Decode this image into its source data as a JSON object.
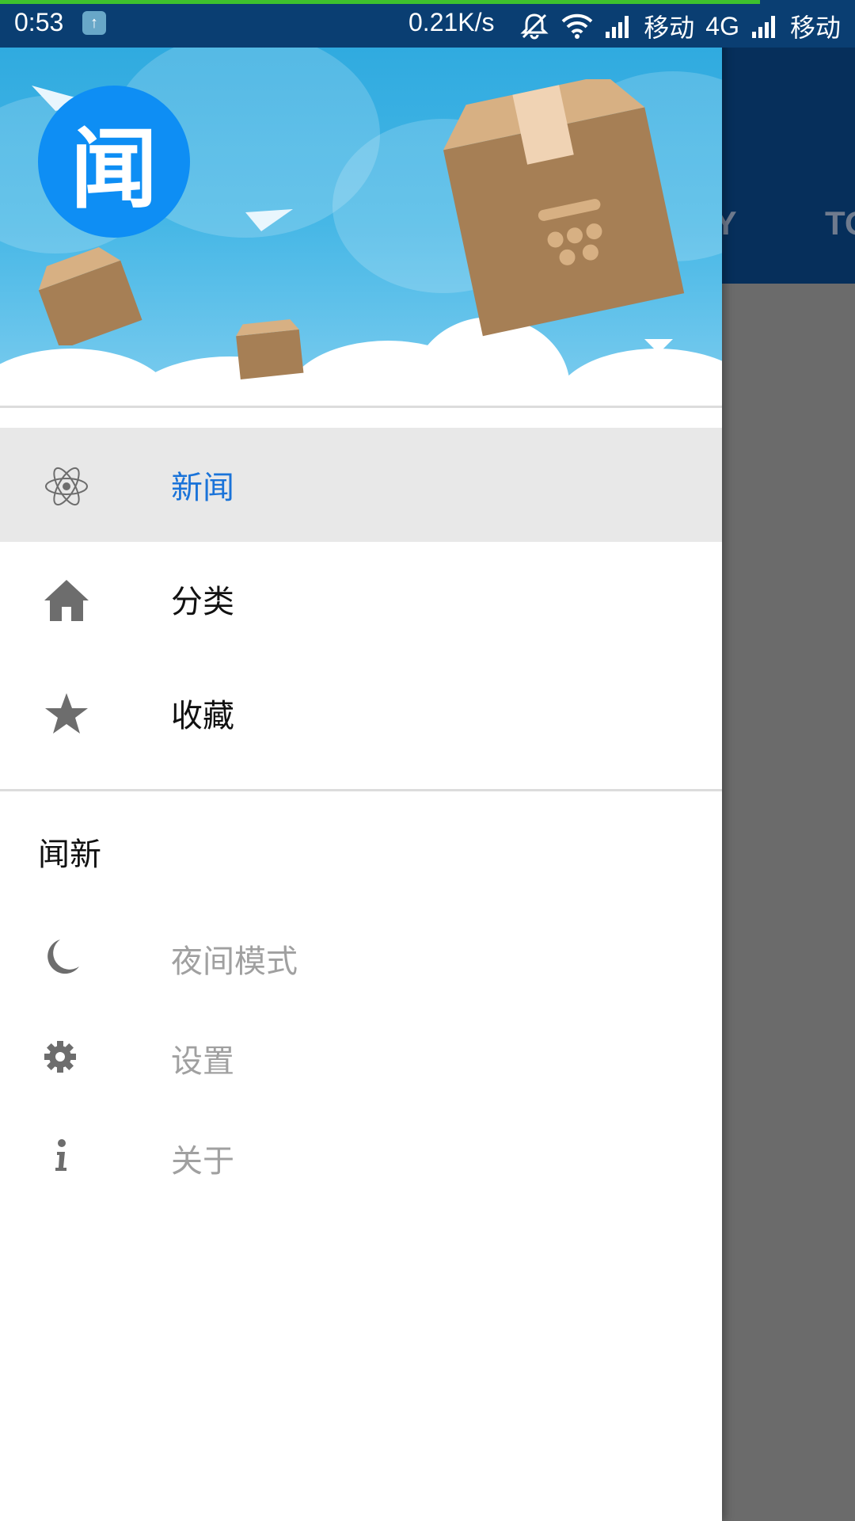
{
  "status_bar": {
    "time": "0:53",
    "net_speed": "0.21K/s",
    "carrier_1": "移动",
    "network_type": "4G",
    "carrier_2": "移动"
  },
  "background_app": {
    "tab_partial_1": "GY",
    "tab_partial_2": "TO"
  },
  "drawer": {
    "avatar_char": "闻",
    "menu": [
      {
        "label": "新闻",
        "icon": "atom-icon",
        "selected": true
      },
      {
        "label": "分类",
        "icon": "home-icon",
        "selected": false
      },
      {
        "label": "收藏",
        "icon": "star-icon",
        "selected": false
      }
    ],
    "section_title": "闻新",
    "secondary_menu": [
      {
        "label": "夜间模式",
        "icon": "moon-icon"
      },
      {
        "label": "设置",
        "icon": "gear-icon"
      },
      {
        "label": "关于",
        "icon": "info-icon"
      }
    ]
  },
  "colors": {
    "accent": "#1a73d9",
    "avatar_bg": "#0e8ef4",
    "toolbar": "#062f5b",
    "status_bar": "#0a3e72"
  }
}
